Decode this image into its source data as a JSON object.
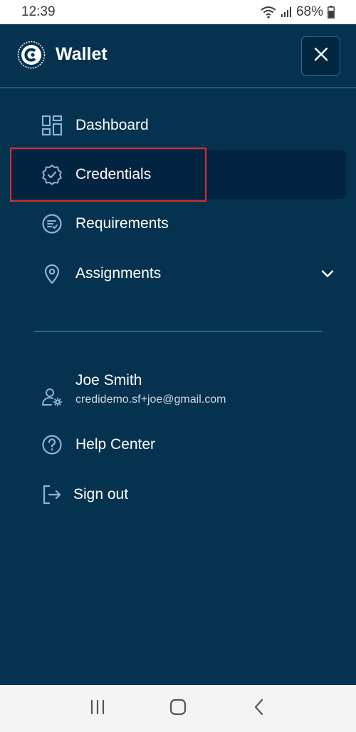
{
  "status_bar": {
    "time": "12:39",
    "battery": "68%",
    "icons": [
      "wifi-icon",
      "signal-icon",
      "battery-icon"
    ]
  },
  "header": {
    "title": "Wallet",
    "close_icon": "close-icon"
  },
  "nav": {
    "items": [
      {
        "label": "Dashboard",
        "icon": "dashboard-icon"
      },
      {
        "label": "Credentials",
        "icon": "badge-check-icon",
        "active": true
      },
      {
        "label": "Requirements",
        "icon": "checklist-icon"
      },
      {
        "label": "Assignments",
        "icon": "location-pin-icon",
        "expandable": true
      }
    ]
  },
  "account": {
    "name": "Joe Smith",
    "email": "credidemo.sf+joe@gmail.com",
    "help_label": "Help Center",
    "signout_label": "Sign out"
  },
  "colors": {
    "background": "#04324f",
    "active_item": "#022440",
    "accent_icon": "#8fb4d3",
    "highlight_border": "#e02a2a"
  },
  "system_nav": [
    "recent-apps-icon",
    "home-icon",
    "back-icon"
  ]
}
